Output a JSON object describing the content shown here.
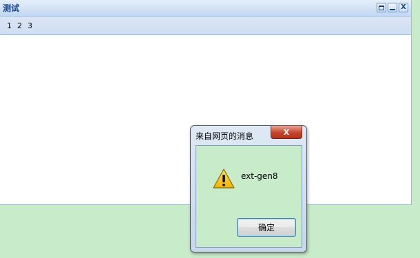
{
  "window": {
    "title": "测试",
    "tools": [
      "maximize-icon",
      "minimize-icon",
      "close-icon"
    ],
    "close_glyph": "X",
    "toolbar": {
      "items": [
        "1",
        "2",
        "3"
      ]
    }
  },
  "alert": {
    "title": "来自网页的消息",
    "close_glyph": "X",
    "icon": "warning-icon",
    "message": "ext-gen8",
    "ok_label": "确定"
  },
  "colors": {
    "page_background": "#c8ebca",
    "header_title": "#15428b",
    "border": "#99bbe8",
    "close_red": "#c6442b"
  }
}
